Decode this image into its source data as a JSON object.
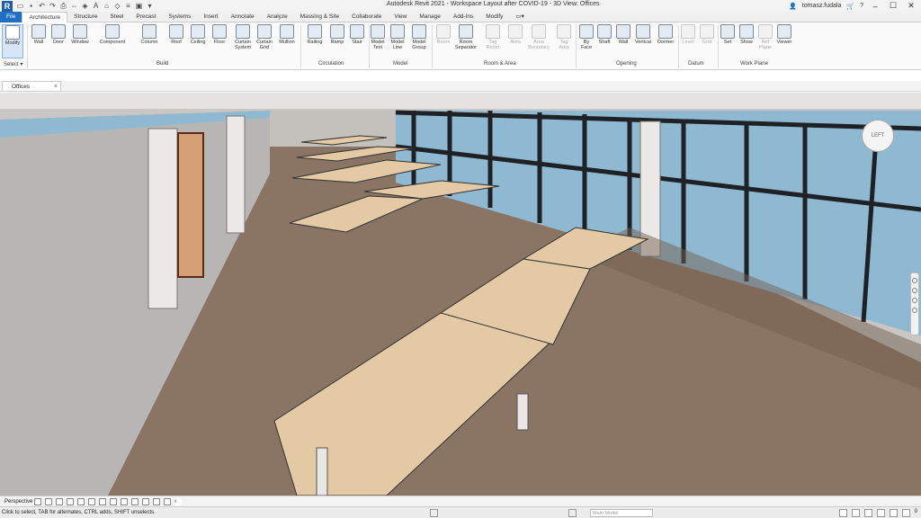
{
  "app": {
    "title": "Autodesk Revit 2021 - Workspace Layout after COVID-19 - 3D View: Offices",
    "user": "tomasz.fudala",
    "logo": "R"
  },
  "tabs": [
    "File",
    "Architecture",
    "Structure",
    "Steel",
    "Precast",
    "Systems",
    "Insert",
    "Annotate",
    "Analyze",
    "Massing & Site",
    "Collaborate",
    "View",
    "Manage",
    "Add-Ins",
    "Modify"
  ],
  "ribbon": {
    "modify": "Modify",
    "select_label": "Select",
    "build": [
      "Wall",
      "Door",
      "Window",
      "Component",
      "Column",
      "Roof",
      "Ceiling",
      "Floor",
      "Curtain\nSystem",
      "Curtain\nGrid",
      "Mullion"
    ],
    "circulation": [
      "Railing",
      "Ramp",
      "Stair"
    ],
    "model": [
      "Model\nText",
      "Model\nLine",
      "Model\nGroup"
    ],
    "room_area": [
      "Room",
      "Room\nSeparator",
      "Tag\nRoom",
      "Area",
      "Area\nBoundary",
      "Tag\nArea"
    ],
    "opening": [
      "By\nFace",
      "Shaft",
      "Wall",
      "Vertical",
      "Dormer"
    ],
    "datum": [
      "Level",
      "Grid"
    ],
    "work_plane": [
      "Set",
      "Show",
      "Ref\nPlane",
      "Viewer"
    ],
    "groups": [
      "Select",
      "Build",
      "Circulation",
      "Model",
      "Room & Area",
      "Opening",
      "Datum",
      "Work Plane"
    ]
  },
  "view_tab": {
    "label": "Offices",
    "close": "×"
  },
  "view_control": {
    "mode": "Perspective"
  },
  "status": {
    "message": "Click to select, TAB for alternates, CTRL adds, SHIFT unselects.",
    "model_placeholder": "Main Model",
    "filter_count": "0"
  },
  "viewcube": {
    "label": "LEFT"
  },
  "colors": {
    "accent": "#1f6fc4",
    "glass": "#8fb9d0",
    "floor": "#8c7565",
    "wall": "#b9b6b4",
    "desk": "#e3c9a4"
  }
}
